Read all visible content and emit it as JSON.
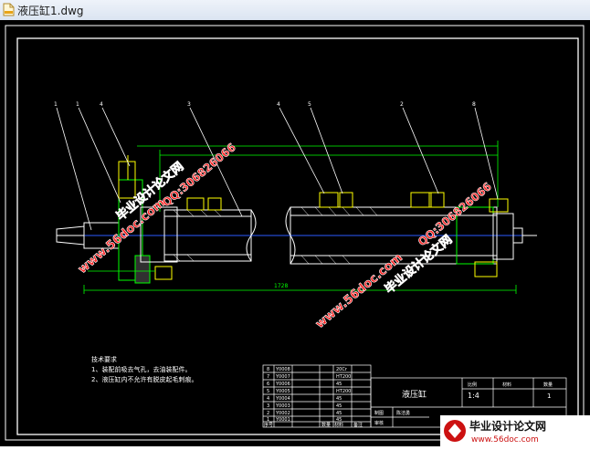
{
  "window": {
    "title": "液压缸1.dwg",
    "icon": "dwg-file-icon"
  },
  "notes": {
    "heading": "技术要求",
    "lines": [
      "1、装配前吸去气孔，去油装配件。",
      "2、液压缸内不允许有脱皮起毛刺痕。"
    ]
  },
  "title_block": {
    "part_name": "液压缸",
    "scale_label": "比例",
    "scale_value": "1:4",
    "material_label": "材料",
    "qty_label": "数量",
    "qty_value": "1",
    "drawn_label": "制图",
    "drawn_name": "陈洁勇",
    "check_label": "审核"
  },
  "bom": {
    "rows": [
      {
        "no": "8",
        "code": "Y0008",
        "mat": "20Cr"
      },
      {
        "no": "7",
        "code": "Y0007",
        "mat": "HT200"
      },
      {
        "no": "6",
        "code": "Y0006",
        "mat": "45"
      },
      {
        "no": "5",
        "code": "Y0005",
        "mat": "HT200"
      },
      {
        "no": "4",
        "code": "Y0004",
        "mat": "45"
      },
      {
        "no": "3",
        "code": "Y0003",
        "mat": "45"
      },
      {
        "no": "2",
        "code": "Y0002",
        "mat": "45"
      },
      {
        "no": "1",
        "code": "Y0001",
        "mat": "45"
      }
    ],
    "header": {
      "no": "序号",
      "qty": "数量",
      "mat": "材料",
      "remark": "备注"
    }
  },
  "callouts": [
    "1",
    "1",
    "4",
    "3",
    "4",
    "5",
    "2",
    "8"
  ],
  "dimension": {
    "overall": "1728"
  },
  "watermarks": {
    "site": "www.56doc.com",
    "qq": "QQ:306826066",
    "brand": "毕业设计论文网"
  },
  "logo": {
    "brand": "毕业设计论文网",
    "url": "www.56doc.com"
  },
  "colors": {
    "background": "#000000",
    "line": "#ffffff",
    "dim": "#00ff00",
    "center": "#2c5bff",
    "part": "#ffff00",
    "wm": "#ff0000"
  }
}
